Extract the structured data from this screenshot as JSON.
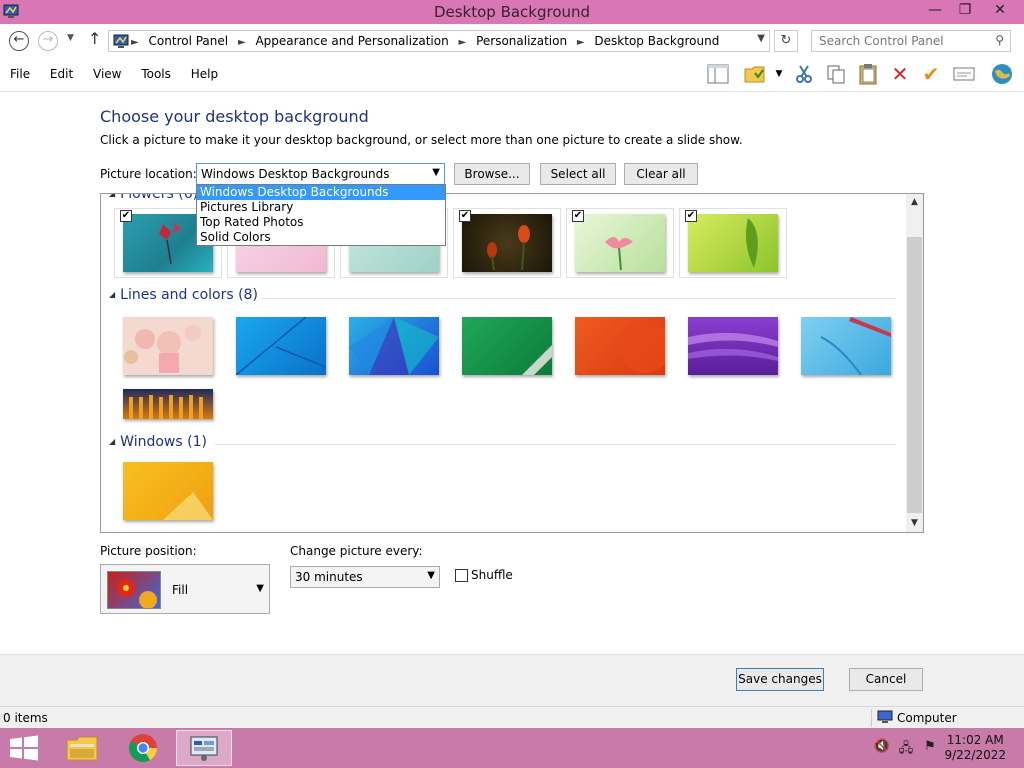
{
  "window": {
    "title": "Desktop Background",
    "minimize": "—",
    "maximize": "❐",
    "close": "✕"
  },
  "address": {
    "breadcrumbs": [
      "Control Panel",
      "Appearance and Personalization",
      "Personalization",
      "Desktop Background"
    ],
    "search_placeholder": "Search Control Panel"
  },
  "menu": [
    "File",
    "Edit",
    "View",
    "Tools",
    "Help"
  ],
  "toolbar_icons": [
    "pane-icon",
    "folder-icon",
    "cut-icon",
    "copy-icon",
    "paste-icon",
    "delete-icon",
    "checkmark-icon",
    "properties-icon",
    "globe-icon"
  ],
  "page": {
    "heading": "Choose your desktop background",
    "subtext": "Click a picture to make it your desktop background, or select more than one picture to create a slide show.",
    "location_label": "Picture location:",
    "location_value": "Windows Desktop Backgrounds",
    "browse": "Browse...",
    "select_all": "Select all",
    "clear_all": "Clear all"
  },
  "dropdown": {
    "options": [
      "Windows Desktop Backgrounds",
      "Pictures Library",
      "Top Rated Photos",
      "Solid Colors"
    ],
    "selected_index": 0
  },
  "gallery": {
    "groups": [
      {
        "name": "Flowers (6)",
        "thumbnails": 6,
        "checked": [
          true,
          true,
          true,
          true,
          true,
          true
        ]
      },
      {
        "name": "Lines and colors (8)",
        "thumbnails": 8
      },
      {
        "name": "Windows (1)",
        "thumbnails": 1
      }
    ]
  },
  "position": {
    "label": "Picture position:",
    "value": "Fill"
  },
  "change": {
    "label": "Change picture every:",
    "value": "30 minutes"
  },
  "shuffle": {
    "label": "Shuffle",
    "checked": false
  },
  "footer": {
    "save": "Save changes",
    "cancel": "Cancel"
  },
  "status": {
    "items": "0 items",
    "computer": "Computer"
  },
  "taskbar": {
    "time": "11:02 AM",
    "date": "9/22/2022"
  },
  "colors": {
    "titlebar": "#d877b4",
    "taskbar": "#c87aa8",
    "heading": "#1e3287",
    "selection": "#3399ff"
  }
}
